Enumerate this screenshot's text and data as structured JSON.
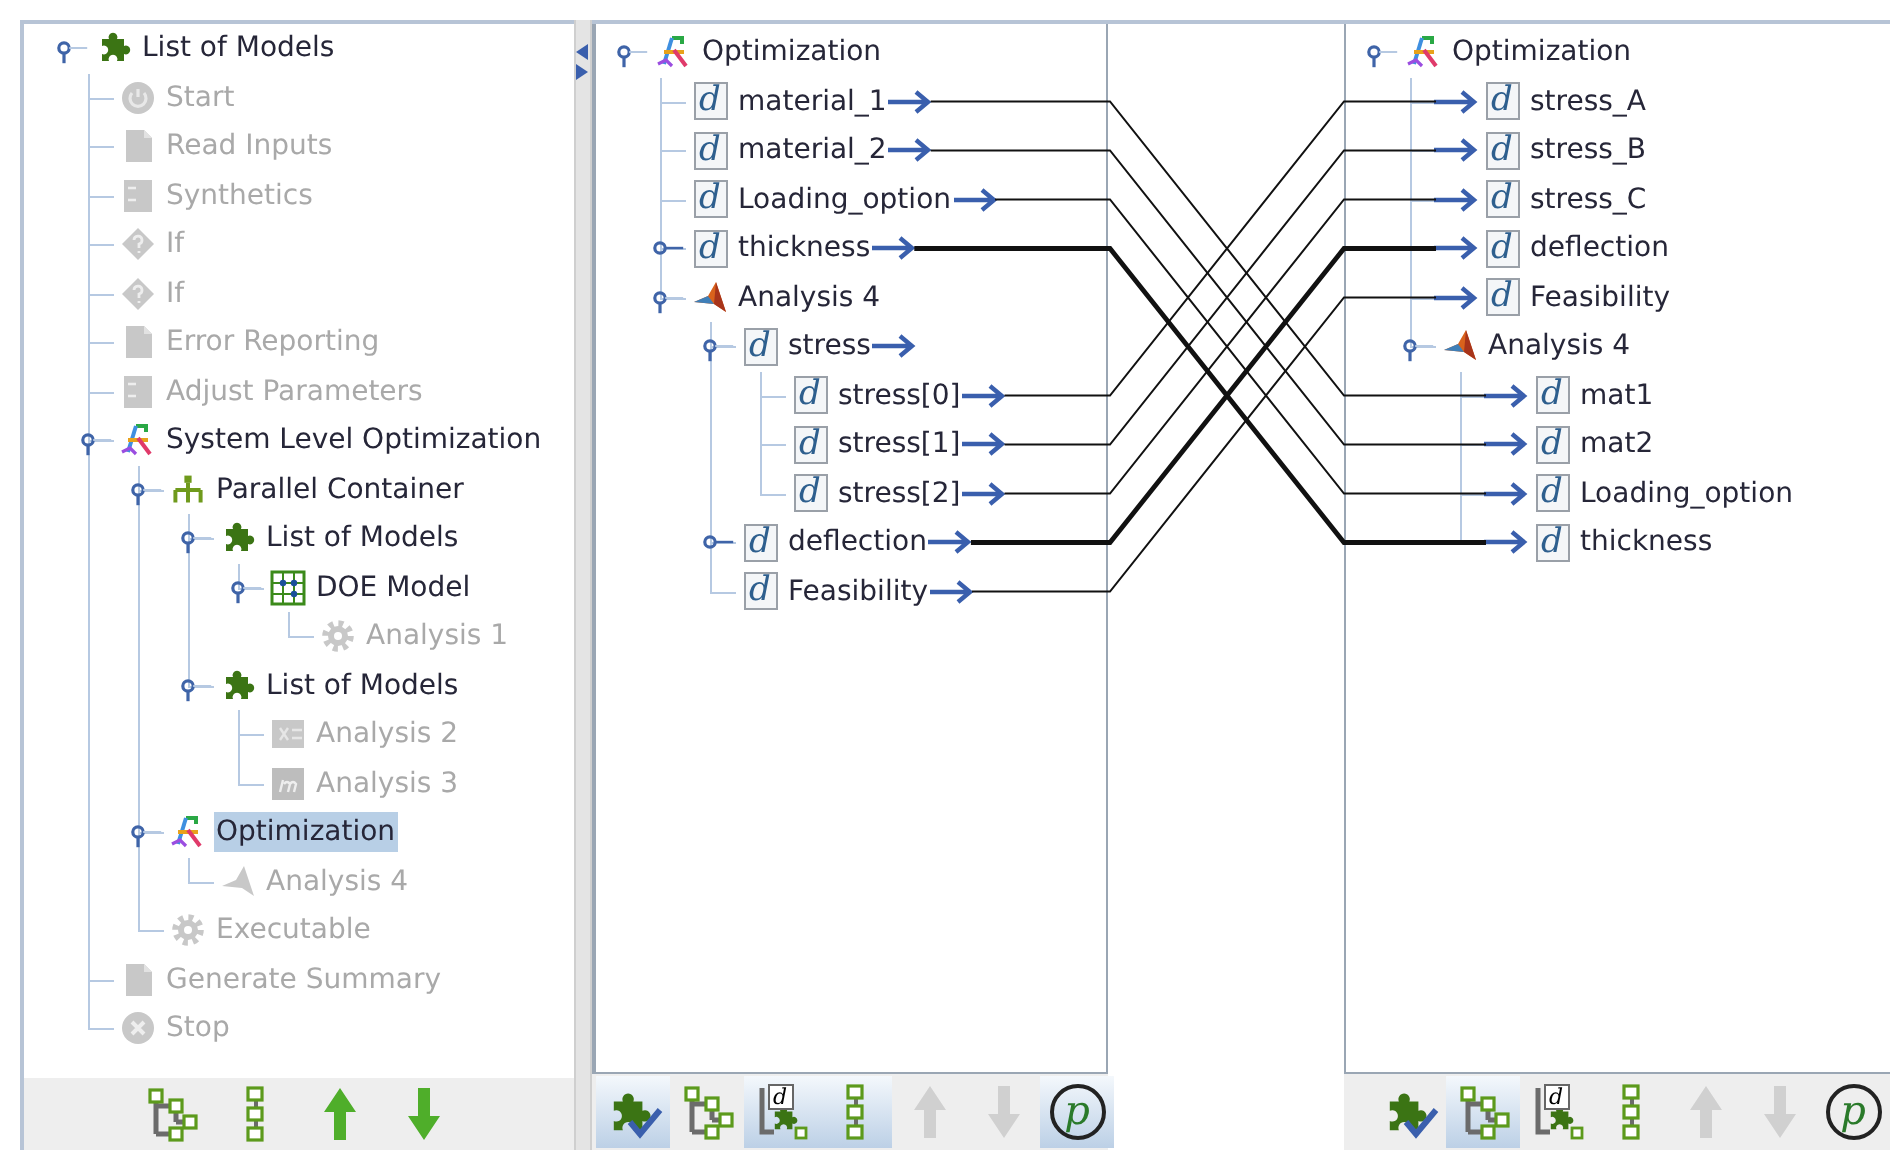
{
  "model_tree": {
    "label": "List of Models",
    "kind": "model-list",
    "expanded": true,
    "disabled": false,
    "selected": false,
    "children": [
      {
        "label": "Start",
        "kind": "start",
        "disabled": true,
        "selected": false
      },
      {
        "label": "Read Inputs",
        "kind": "document",
        "disabled": true,
        "selected": false
      },
      {
        "label": "Synthetics",
        "kind": "synthetics",
        "disabled": true,
        "selected": false
      },
      {
        "label": "If",
        "kind": "condition",
        "disabled": true,
        "selected": false
      },
      {
        "label": "If",
        "kind": "condition",
        "disabled": true,
        "selected": false
      },
      {
        "label": "Error Reporting",
        "kind": "document",
        "disabled": true,
        "selected": false
      },
      {
        "label": "Adjust Parameters",
        "kind": "synthetics",
        "disabled": true,
        "selected": false
      },
      {
        "label": "System Level Optimization",
        "kind": "optimization",
        "expanded": true,
        "disabled": false,
        "selected": false,
        "children": [
          {
            "label": "Parallel Container",
            "kind": "parallel",
            "expanded": true,
            "disabled": false,
            "selected": false,
            "children": [
              {
                "label": "List of Models",
                "kind": "model-list",
                "expanded": true,
                "disabled": false,
                "selected": false,
                "children": [
                  {
                    "label": "DOE Model",
                    "kind": "doe",
                    "expanded": true,
                    "disabled": false,
                    "selected": false,
                    "children": [
                      {
                        "label": "Analysis 1",
                        "kind": "gear",
                        "disabled": true,
                        "selected": false
                      }
                    ]
                  }
                ]
              },
              {
                "label": "List of Models",
                "kind": "model-list",
                "expanded": true,
                "disabled": false,
                "selected": false,
                "children": [
                  {
                    "label": "Analysis 2",
                    "kind": "sheet",
                    "disabled": true,
                    "selected": false
                  },
                  {
                    "label": "Analysis 3",
                    "kind": "mathcad",
                    "disabled": true,
                    "selected": false
                  }
                ]
              }
            ]
          },
          {
            "label": "Optimization",
            "kind": "optimization",
            "expanded": true,
            "disabled": false,
            "selected": true,
            "children": [
              {
                "label": "Analysis 4",
                "kind": "cone",
                "disabled": true,
                "selected": false
              }
            ]
          },
          {
            "label": "Executable",
            "kind": "gear",
            "disabled": true,
            "selected": false
          }
        ]
      },
      {
        "label": "Generate Summary",
        "kind": "document",
        "disabled": true,
        "selected": false
      },
      {
        "label": "Stop",
        "kind": "stop",
        "disabled": true,
        "selected": false
      }
    ]
  },
  "model_toolbar": [
    {
      "kind": "hierarchy",
      "disabled": false
    },
    {
      "kind": "chain",
      "disabled": false
    },
    {
      "kind": "up",
      "disabled": false
    },
    {
      "kind": "down",
      "disabled": false
    }
  ],
  "source_tree": {
    "label": "Optimization",
    "kind": "optimization",
    "expanded": true,
    "children": [
      {
        "label": "material_1",
        "kind": "variable",
        "icon": "d"
      },
      {
        "label": "material_2",
        "kind": "variable",
        "icon": "d"
      },
      {
        "label": "Loading_option",
        "kind": "variable",
        "icon": "d"
      },
      {
        "label": "thickness",
        "kind": "variable",
        "icon": "d",
        "expanded": false
      },
      {
        "label": "Analysis 4",
        "kind": "cone",
        "expanded": true,
        "children": [
          {
            "label": "stress",
            "kind": "variable",
            "icon": "d",
            "expanded": true,
            "children": [
              {
                "label": "stress[0]",
                "kind": "variable",
                "icon": "d"
              },
              {
                "label": "stress[1]",
                "kind": "variable",
                "icon": "d"
              },
              {
                "label": "stress[2]",
                "kind": "variable",
                "icon": "d"
              }
            ]
          },
          {
            "label": "deflection",
            "kind": "variable",
            "icon": "d",
            "expanded": false
          },
          {
            "label": "Feasibility",
            "kind": "variable",
            "icon": "d"
          }
        ]
      }
    ]
  },
  "target_tree": {
    "label": "Optimization",
    "kind": "optimization",
    "expanded": true,
    "children": [
      {
        "label": "stress_A",
        "kind": "variable",
        "icon": "d"
      },
      {
        "label": "stress_B",
        "kind": "variable",
        "icon": "d"
      },
      {
        "label": "stress_C",
        "kind": "variable",
        "icon": "d"
      },
      {
        "label": "deflection",
        "kind": "variable",
        "icon": "d"
      },
      {
        "label": "Feasibility",
        "kind": "variable",
        "icon": "d"
      },
      {
        "label": "Analysis 4",
        "kind": "cone",
        "expanded": true,
        "children": [
          {
            "label": "mat1",
            "kind": "variable",
            "icon": "d"
          },
          {
            "label": "mat2",
            "kind": "variable",
            "icon": "d"
          },
          {
            "label": "Loading_option",
            "kind": "variable",
            "icon": "d"
          },
          {
            "label": "thickness",
            "kind": "variable",
            "icon": "d"
          }
        ]
      }
    ]
  },
  "source_toolbar": [
    {
      "kind": "model-check",
      "selected": true,
      "disabled": false
    },
    {
      "kind": "hierarchy",
      "selected": false,
      "disabled": false
    },
    {
      "kind": "var-tree",
      "glyph": "d",
      "selected": true,
      "disabled": false
    },
    {
      "kind": "chain",
      "selected": true,
      "disabled": false
    },
    {
      "kind": "up",
      "selected": false,
      "disabled": true
    },
    {
      "kind": "down",
      "selected": false,
      "disabled": true
    },
    {
      "kind": "param",
      "glyph": "p",
      "selected": true,
      "disabled": false
    }
  ],
  "target_toolbar": [
    {
      "kind": "model-check",
      "selected": false,
      "disabled": false
    },
    {
      "kind": "hierarchy",
      "selected": true,
      "disabled": false
    },
    {
      "kind": "var-tree",
      "glyph": "d",
      "selected": false,
      "disabled": false
    },
    {
      "kind": "chain",
      "selected": false,
      "disabled": false
    },
    {
      "kind": "up",
      "selected": false,
      "disabled": true
    },
    {
      "kind": "down",
      "selected": false,
      "disabled": true
    },
    {
      "kind": "param",
      "glyph": "p",
      "selected": false,
      "disabled": false
    }
  ]
}
